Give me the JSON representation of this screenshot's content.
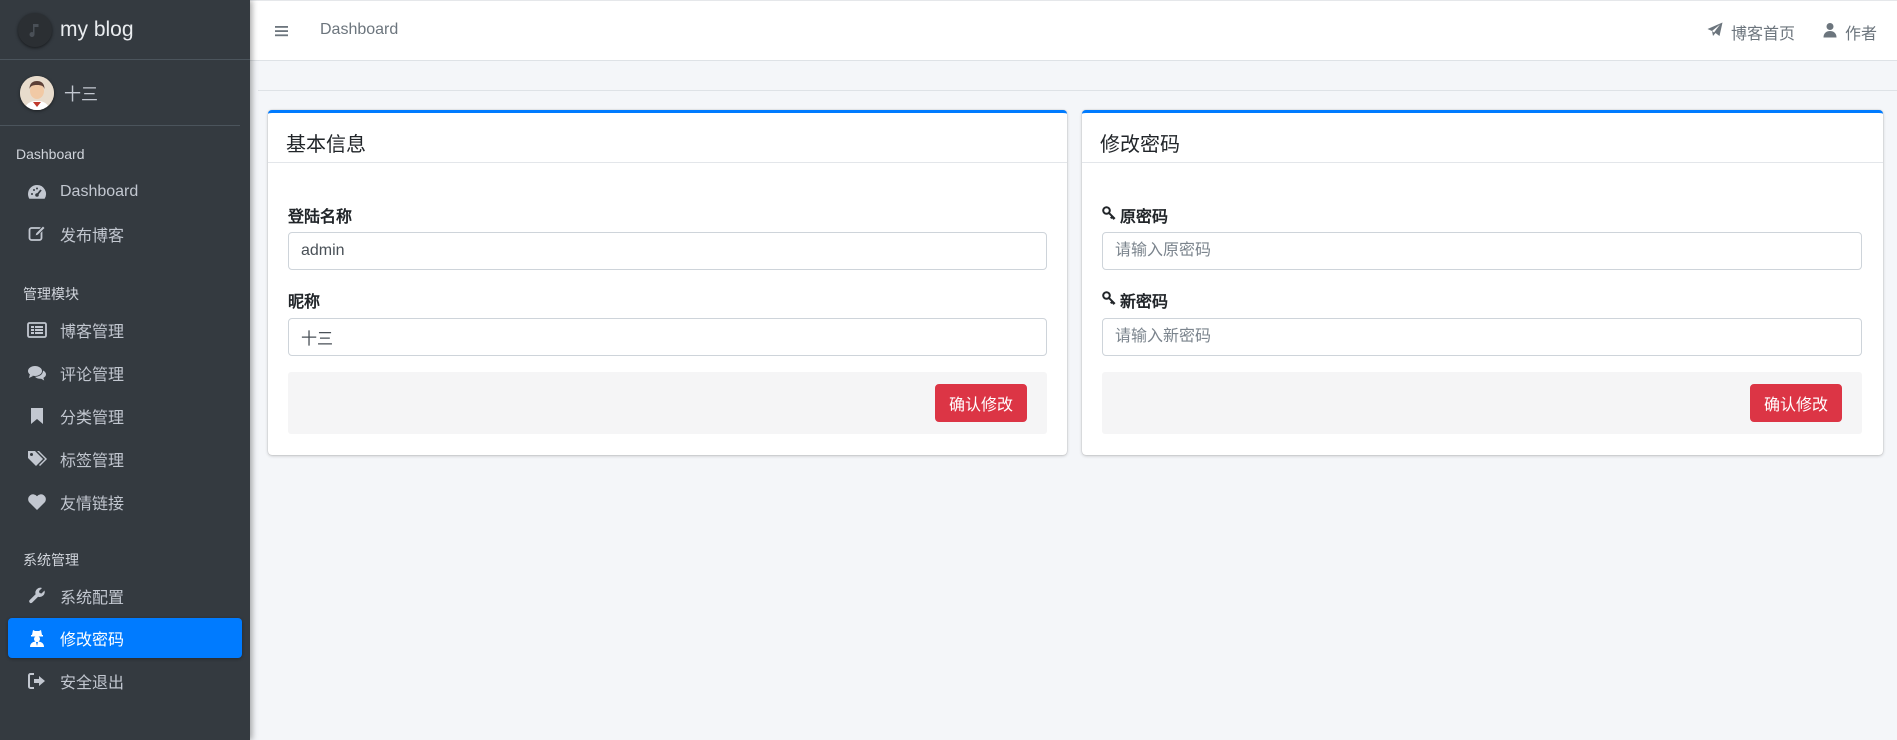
{
  "app": {
    "title": "my blog"
  },
  "user": {
    "name": "十三"
  },
  "sidebar": {
    "sections": [
      {
        "header": "Dashboard",
        "items": [
          {
            "label": "Dashboard",
            "icon": "tachometer-icon"
          },
          {
            "label": "发布博客",
            "icon": "edit-icon"
          }
        ]
      },
      {
        "header": "管理模块",
        "items": [
          {
            "label": "博客管理",
            "icon": "list-icon"
          },
          {
            "label": "评论管理",
            "icon": "comments-icon"
          },
          {
            "label": "分类管理",
            "icon": "bookmark-icon"
          },
          {
            "label": "标签管理",
            "icon": "tags-icon"
          },
          {
            "label": "友情链接",
            "icon": "heart-icon"
          }
        ]
      },
      {
        "header": "系统管理",
        "items": [
          {
            "label": "系统配置",
            "icon": "wrench-icon"
          },
          {
            "label": "修改密码",
            "icon": "user-secret-icon",
            "active": true
          },
          {
            "label": "安全退出",
            "icon": "sign-out-icon"
          }
        ]
      }
    ]
  },
  "topbar": {
    "breadcrumb": "Dashboard",
    "links": [
      {
        "label": "博客首页",
        "icon": "paper-plane-icon"
      },
      {
        "label": "作者",
        "icon": "user-icon"
      }
    ]
  },
  "basic_info": {
    "title": "基本信息",
    "login_name_label": "登陆名称",
    "login_name_value": "admin",
    "nickname_label": "昵称",
    "nickname_value": "十三",
    "submit_label": "确认修改"
  },
  "change_password": {
    "title": "修改密码",
    "old_password_label": "原密码",
    "old_password_placeholder": "请输入原密码",
    "new_password_label": "新密码",
    "new_password_placeholder": "请输入新密码",
    "submit_label": "确认修改"
  },
  "colors": {
    "sidebar_bg": "#343a40",
    "accent": "#007bff",
    "danger": "#dc3545",
    "content_bg": "#f4f6f9"
  }
}
